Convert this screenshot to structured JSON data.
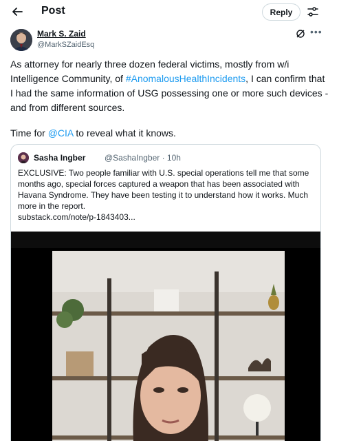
{
  "header": {
    "title": "Post",
    "back_icon": "arrow-left-icon",
    "reply_label": "Reply",
    "settings_icon": "sliders-icon"
  },
  "tweet": {
    "author_name": "Mark S. Zaid",
    "author_handle": "@MarkSZaidEsq",
    "text_part1": "As attorney for nearly three dozen federal victims, mostly from w/i Intelligence Community, of ",
    "hashtag": "#AnomalousHealthIncidents",
    "text_part2": ", I can confirm that I had the same information of USG possessing one or more such devices - and from different sources.",
    "line2_before": "Time for ",
    "mention": "@CIA",
    "line2_after": " to reveal what it knows."
  },
  "quote": {
    "author_name": "Sasha Ingber",
    "author_handle_time": "@SashaIngber · 10h",
    "text": "EXCLUSIVE: Two people familiar with U.S. special operations tell me that some months ago, special forces captured a weapon that has been associated with Havana Syndrome. They have been testing it to understand how it works. Much more in the report.",
    "link": "substack.com/note/p-1843403..."
  },
  "colors": {
    "accent": "#1d9bf0",
    "text": "#0f1419",
    "muted": "#536471",
    "border": "#cfd9de"
  }
}
